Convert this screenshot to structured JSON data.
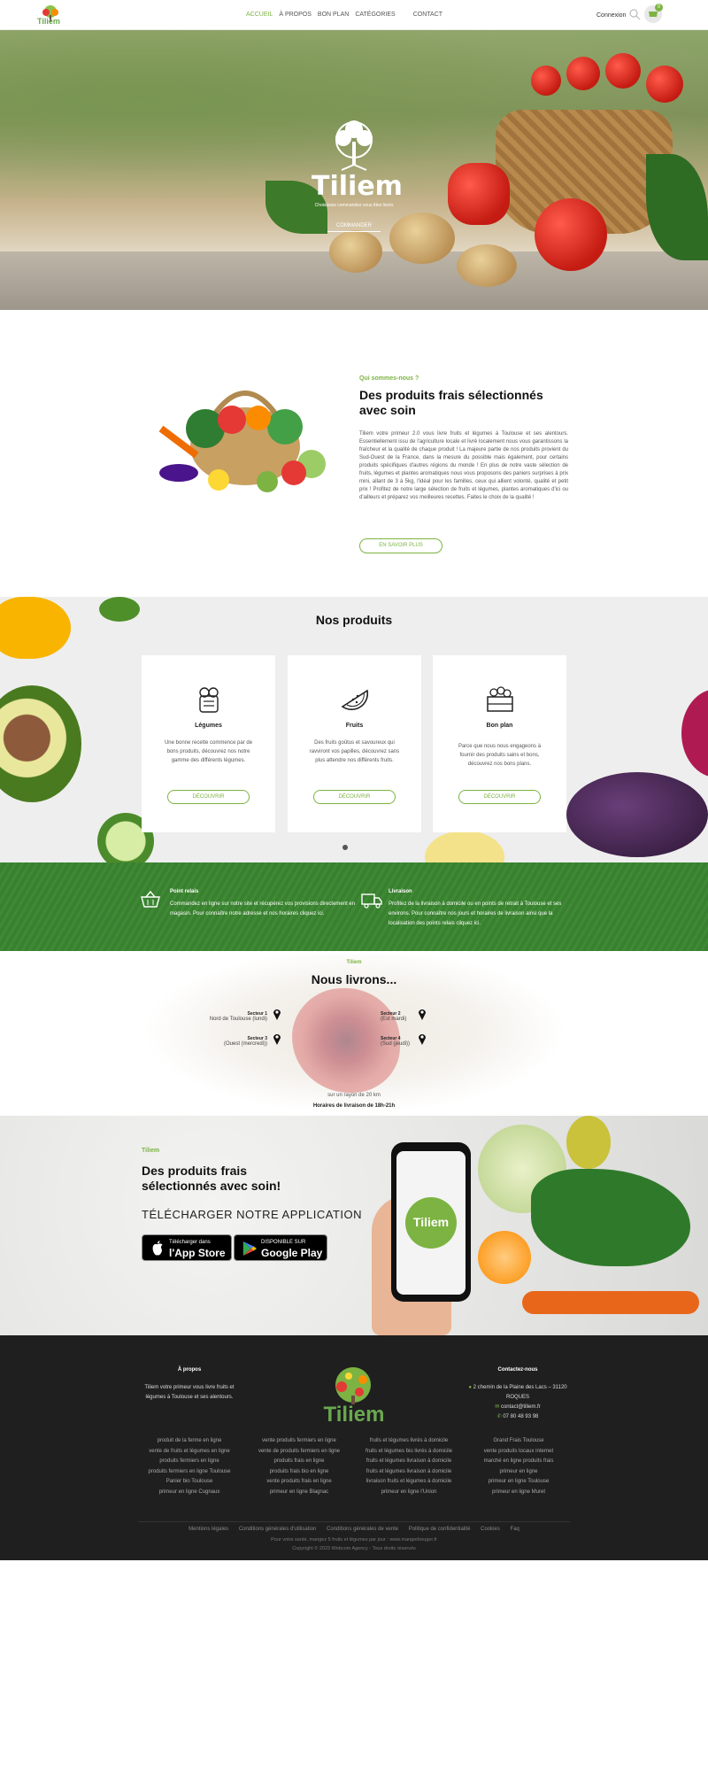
{
  "nav": {
    "logo_text": "Tiliem",
    "menu": [
      "ACCUEIL",
      "À PROPOS",
      "BON PLAN",
      "CATÉGORIES",
      "CONTACT"
    ],
    "active": "ACCUEIL",
    "login": "Connexion",
    "cart_count": "0"
  },
  "hero": {
    "brand": "Tiliem",
    "tagline": "Choisissez commandez vous êtes livrés",
    "button": "COMMANDER"
  },
  "about": {
    "kicker": "Qui sommes-nous ?",
    "title": "Des produits frais sélectionnés avec soin",
    "text": "Tiliem votre primeur 2.0 vous livre fruits et légumes à Toulouse et ses alentours. Essentiellement issu de l'agriculture locale et livré localement nous vous garantissons la fraîcheur et la qualité de chaque produit ! La majeure partie de nos produits provient du Sud-Ouest de la France, dans la mesure du possible mais également, pour certains produits spécifiques d'autres régions du monde ! En plus de notre vaste sélection de fruits, légumes et plantes aromatiques nous vous proposons des paniers surprises à prix mini, allant de 3 à 5kg, l'idéal pour les familles, ceux qui allient volonté, qualité et petit prix ! Profitez de notre large sélection de fruits et légumes, plantes aromatiques d'ici ou d'ailleurs et préparez vos meilleures recettes. Faites le choix de la qualité !",
    "button": "EN SAVOIR PLUS"
  },
  "products": {
    "title": "Nos produits",
    "cards": [
      {
        "name": "Légumes",
        "desc": "Une bonne recette commence par de bons produits, découvrez nos notre gamme des différents légumes.",
        "button": "DÉCOUVRIR",
        "icon": "vegetables-icon"
      },
      {
        "name": "Fruits",
        "desc": "Des fruits goûtus et savoureux qui ravviront vos papilles, découvrez sans plus attendre nos différents fruits.",
        "button": "DÉCOUVRIR",
        "icon": "watermelon-icon"
      },
      {
        "name": "Bon plan",
        "desc": "Parce que nous nous engageons à fournir des produits sains et bons, découvrez nos bons plans.",
        "button": "DÉCOUVRIR",
        "icon": "crate-icon"
      }
    ]
  },
  "services": [
    {
      "head": "Point relais",
      "text": "Commandez en ligne sur notre site et récupérez vos provisions directement en magasin. Pour connaître notre adresse et nos horaires cliquez ici.",
      "icon": "basket-icon"
    },
    {
      "head": "Livraison",
      "text": "Profitez de la livraison à domicile ou en points de retrait à Toulouse et ses environs. Pour connaître nos jours et horaires de livraison ainsi que la localisation des points relais cliquez ici.",
      "icon": "delivery-truck-icon"
    }
  ],
  "delivery": {
    "kicker": "Tiliem",
    "title": "Nous livrons...",
    "sectors": [
      {
        "label": "Secteur 1",
        "area": "Nord de Toulouse (lundi)"
      },
      {
        "label": "Secteur 2",
        "area": "(Est mardi)"
      },
      {
        "label": "Secteur 3",
        "area": "(Ouest (mercredi))"
      },
      {
        "label": "Secteur 4",
        "area": "(Sud (jeudi))"
      }
    ],
    "radius": "sur un rayon de 20 km",
    "hours": "Horaires de livraison de 18h-21h"
  },
  "app": {
    "kicker": "Tiliem",
    "title": "Des produits frais sélectionnés avec soin!",
    "download": "TÉLÉCHARGER NOTRE APPLICATION",
    "appstore_small": "Télécharger dans",
    "appstore_large": "l'App Store",
    "play_small": "DISPONIBLE SUR",
    "play_large": "Google Play",
    "phone_logo": "Tiliem"
  },
  "footer": {
    "about_head": "À propos",
    "about_text": "Tiliem votre primeur vous livre fruits et légumes à Toulouse et ses alentours.",
    "logo_text": "Tiliem",
    "contact_head": "Contactez-nous",
    "address": "2 chemin de la Plaine des Lacs – 31120 ROQUES",
    "email": "contact@tiliem.fr",
    "phone": "07 80 48 93 98",
    "link_cols": [
      [
        "produit de la ferme en ligne",
        "vente de fruits et légumes en ligne",
        "produits fermiers en ligne",
        "produits fermiers en ligne Toulouse",
        "Panier bio Toulouse",
        "primeur en ligne Cugnaux"
      ],
      [
        "vente produits fermiers en ligne",
        "vente de produits fermiers en ligne",
        "produits frais en ligne",
        "produits frais bio en ligne",
        "vente produits frais en ligne",
        "primeur en ligne Blagnac"
      ],
      [
        "fruits et légumes livrés à domicile",
        "fruits et légumes bio livrés à domicile",
        "fruits et légumes livraison à domicile",
        "fruits et légumes livraison à domicile",
        "livraison fruits et légumes à domicile",
        "primeur en ligne l'Union"
      ],
      [
        "Grand Frais Toulouse",
        "vente produits locaux internet",
        "marché en ligne produits frais",
        "primeur en ligne",
        "primeur en ligne Toulouse",
        "primeur en ligne Muret"
      ]
    ],
    "legal": [
      "Mentions légales",
      "Conditions générales d'utilisation",
      "Conditions générales de vente",
      "Politique de confidentialité",
      "Cookies",
      "Faq"
    ],
    "health": "Pour votre santé, mangez 5 fruits et légumes par jour : www.mangerbouger.fr",
    "copyright": "Copyright © 2023 Webcom Agency - Tous droits réservés"
  }
}
